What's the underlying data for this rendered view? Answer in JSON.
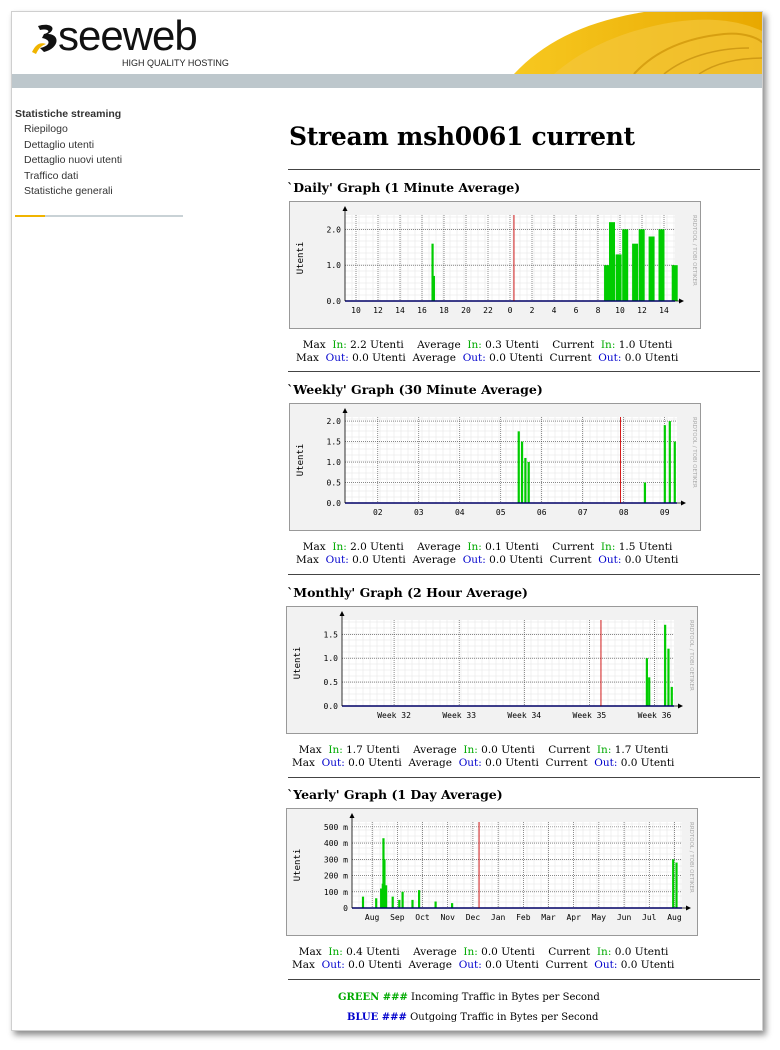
{
  "header": {
    "logo_word": "seeweb",
    "logo_tagline": "HIGH QUALITY HOSTING"
  },
  "sidebar": {
    "title": "Statistiche streaming",
    "items": [
      "Riepilogo",
      "Dettaglio utenti",
      "Dettaglio nuovi utenti",
      "Traffico dati",
      "Statistiche generali"
    ]
  },
  "page_title": "Stream msh0061 current",
  "graphs": [
    {
      "title": "`Daily' Graph (1 Minute Average)"
    },
    {
      "title": "`Weekly' Graph (30 Minute Average)"
    },
    {
      "title": "`Monthly' Graph (2 Hour Average)"
    },
    {
      "title": "`Yearly' Graph (1 Day Average)"
    }
  ],
  "stats": [
    {
      "max_in": "2.2 Utenti",
      "avg_in": "0.3 Utenti",
      "cur_in": "1.0 Utenti",
      "max_out": "0.0 Utenti",
      "avg_out": "0.0 Utenti",
      "cur_out": "0.0 Utenti"
    },
    {
      "max_in": "2.0 Utenti",
      "avg_in": "0.1 Utenti",
      "cur_in": "1.5 Utenti",
      "max_out": "0.0 Utenti",
      "avg_out": "0.0 Utenti",
      "cur_out": "0.0 Utenti"
    },
    {
      "max_in": "1.7 Utenti",
      "avg_in": "0.0 Utenti",
      "cur_in": "1.7 Utenti",
      "max_out": "0.0 Utenti",
      "avg_out": "0.0 Utenti",
      "cur_out": "0.0 Utenti"
    },
    {
      "max_in": "0.4 Utenti",
      "avg_in": "0.0 Utenti",
      "cur_in": "0.0 Utenti",
      "max_out": "0.0 Utenti",
      "avg_out": "0.0 Utenti",
      "cur_out": "0.0 Utenti"
    }
  ],
  "labels": {
    "max": "Max",
    "average": "Average",
    "current": "Current",
    "in": "In:",
    "out": "Out:"
  },
  "legend": {
    "green_key": "GREEN ###",
    "green_text": "Incoming Traffic in Bytes per Second",
    "blue_key": "BLUE ###",
    "blue_text": "Outgoing Traffic in Bytes per Second"
  },
  "rrdtool_label": "RRDTOOL / TOBI OETIKER",
  "chart_data": [
    {
      "type": "area",
      "title": "`Daily' Graph (1 Minute Average)",
      "ylabel": "Utenti",
      "y_ticks": [
        "0.0",
        "1.0",
        "2.0"
      ],
      "ylim": [
        0,
        2.4
      ],
      "x_ticks": [
        "10",
        "12",
        "14",
        "16",
        "18",
        "20",
        "22",
        "0",
        "2",
        "4",
        "6",
        "8",
        "10",
        "12",
        "14"
      ],
      "series": [
        {
          "name": "In",
          "color": "#00cc00",
          "points": [
            [
              0.262,
              1.6
            ],
            [
              0.266,
              0.7
            ],
            [
              0.785,
              1.0
            ],
            [
              0.8,
              2.2
            ],
            [
              0.82,
              1.3
            ],
            [
              0.84,
              2.0
            ],
            [
              0.87,
              1.6
            ],
            [
              0.89,
              2.0
            ],
            [
              0.92,
              1.8
            ],
            [
              0.95,
              2.0
            ],
            [
              0.99,
              1.0
            ]
          ]
        },
        {
          "name": "Out",
          "color": "#0000cc",
          "values": [
            0.0
          ]
        }
      ],
      "markers": [
        0.512
      ]
    },
    {
      "type": "area",
      "title": "`Weekly' Graph (30 Minute Average)",
      "ylabel": "Utenti",
      "y_ticks": [
        "0.0",
        "0.5",
        "1.0",
        "1.5",
        "2.0"
      ],
      "ylim": [
        0,
        2.1
      ],
      "x_ticks": [
        "02",
        "03",
        "04",
        "05",
        "06",
        "07",
        "08",
        "09"
      ],
      "series": [
        {
          "name": "In",
          "color": "#00cc00",
          "points": [
            [
              0.52,
              1.75
            ],
            [
              0.53,
              1.5
            ],
            [
              0.54,
              1.1
            ],
            [
              0.55,
              1.0
            ],
            [
              0.9,
              0.5
            ],
            [
              0.96,
              1.9
            ],
            [
              0.975,
              2.0
            ],
            [
              0.99,
              1.5
            ]
          ]
        },
        {
          "name": "Out",
          "color": "#0000cc",
          "values": [
            0.0
          ]
        }
      ],
      "markers": [
        0.83
      ]
    },
    {
      "type": "area",
      "title": "`Monthly' Graph (2 Hour Average)",
      "ylabel": "Utenti",
      "y_ticks": [
        "0.0",
        "0.5",
        "1.0",
        "1.5"
      ],
      "ylim": [
        0,
        1.8
      ],
      "x_ticks": [
        "Week 32",
        "Week 33",
        "Week 34",
        "Week 35",
        "Week 36"
      ],
      "series": [
        {
          "name": "In",
          "color": "#00cc00",
          "points": [
            [
              0.915,
              1.0
            ],
            [
              0.922,
              0.6
            ],
            [
              0.97,
              1.7
            ],
            [
              0.98,
              1.2
            ],
            [
              0.99,
              0.4
            ]
          ]
        },
        {
          "name": "Out",
          "color": "#0000cc",
          "values": [
            0.0
          ]
        }
      ],
      "markers": [
        0.78
      ]
    },
    {
      "type": "area",
      "title": "`Yearly' Graph (1 Day Average)",
      "ylabel": "Utenti",
      "y_ticks": [
        "0",
        "100 m",
        "200 m",
        "300 m",
        "400 m",
        "500 m"
      ],
      "ylim": [
        0,
        0.53
      ],
      "x_ticks": [
        "Aug",
        "Sep",
        "Oct",
        "Nov",
        "Dec",
        "Jan",
        "Feb",
        "Mar",
        "Apr",
        "May",
        "Jun",
        "Jul",
        "Aug"
      ],
      "series": [
        {
          "name": "In",
          "color": "#00cc00",
          "points": [
            [
              0.03,
              0.07
            ],
            [
              0.07,
              0.06
            ],
            [
              0.085,
              0.12
            ],
            [
              0.09,
              0.15
            ],
            [
              0.092,
              0.43
            ],
            [
              0.095,
              0.3
            ],
            [
              0.1,
              0.14
            ],
            [
              0.12,
              0.07
            ],
            [
              0.14,
              0.05
            ],
            [
              0.15,
              0.1
            ],
            [
              0.18,
              0.05
            ],
            [
              0.2,
              0.11
            ],
            [
              0.25,
              0.04
            ],
            [
              0.3,
              0.03
            ],
            [
              0.97,
              0.3
            ],
            [
              0.98,
              0.28
            ]
          ]
        },
        {
          "name": "Out",
          "color": "#0000cc",
          "values": [
            0.0
          ]
        }
      ],
      "markers": [
        0.385
      ]
    }
  ]
}
